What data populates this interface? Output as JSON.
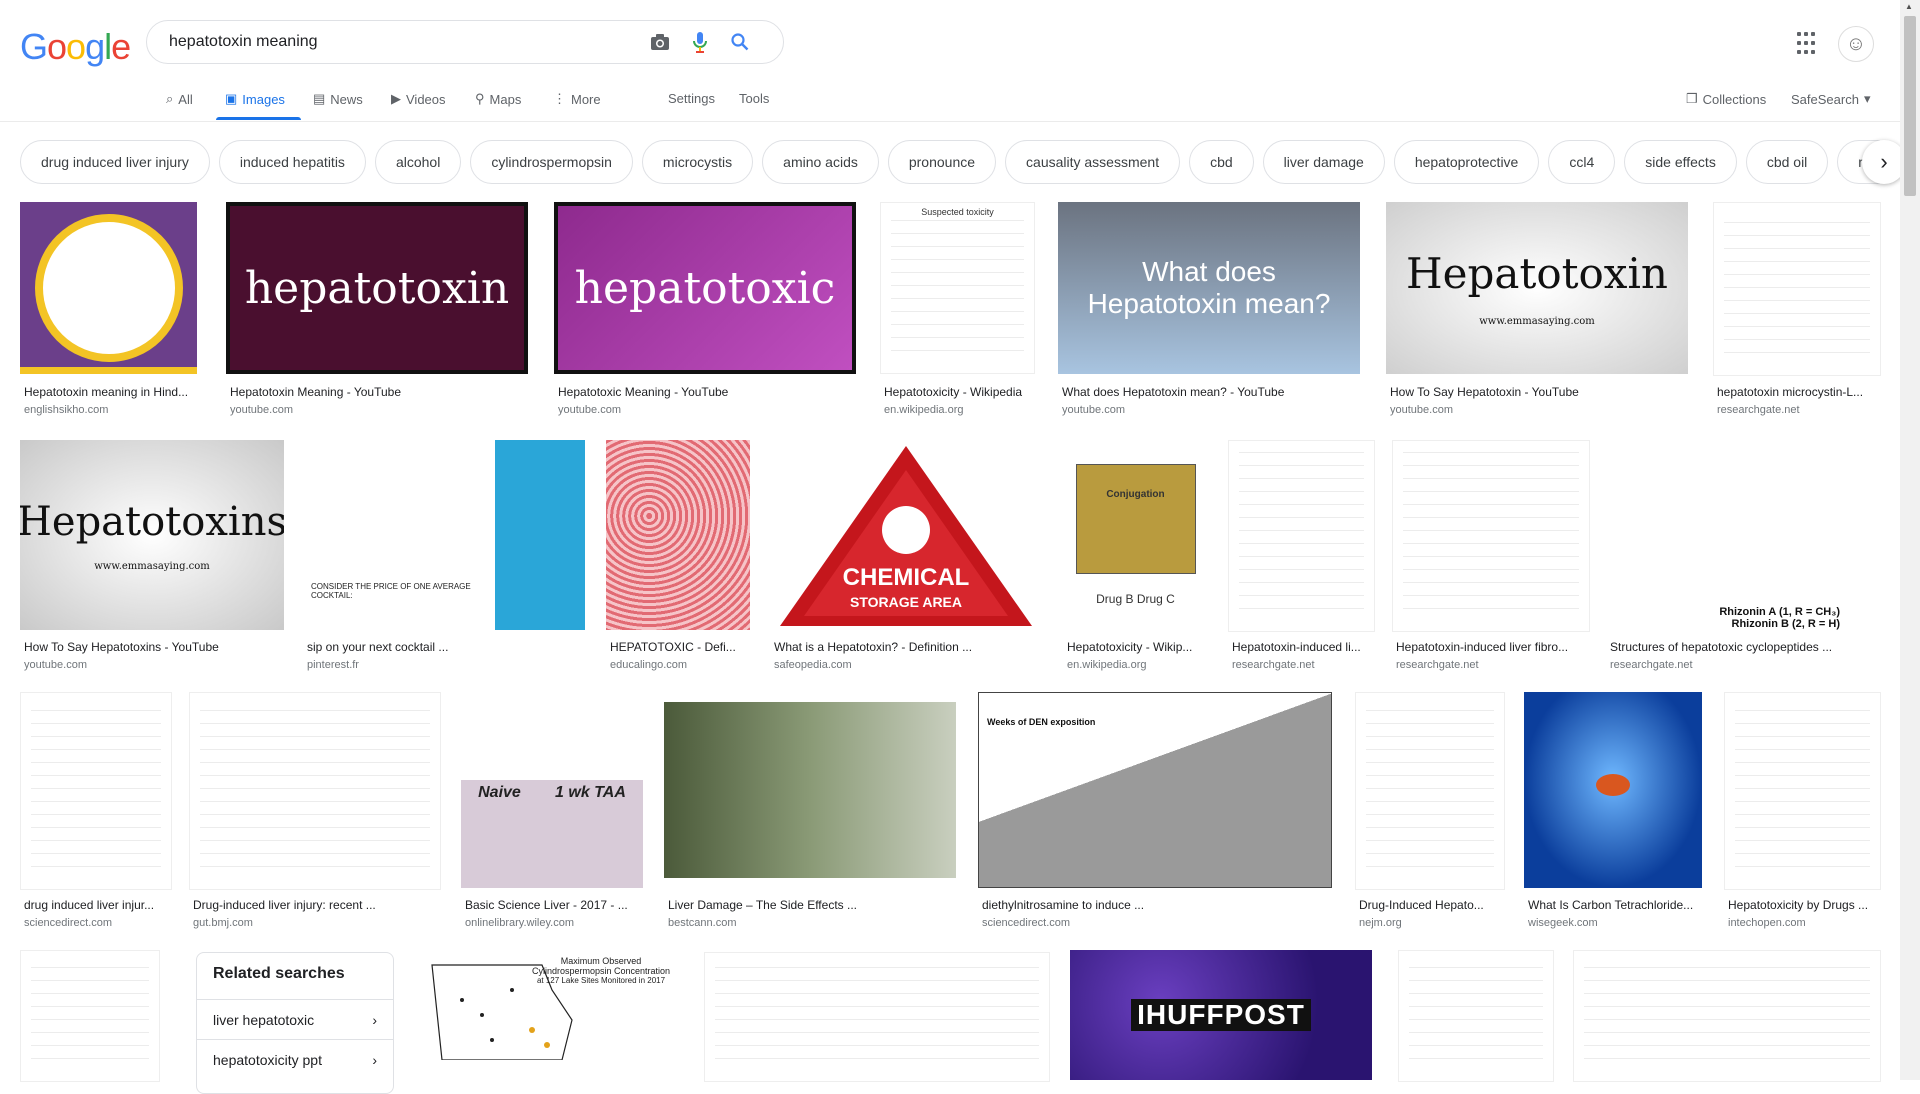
{
  "logo": {
    "g1": "G",
    "o1": "o",
    "o2": "o",
    "g2": "g",
    "l": "l",
    "e": "e"
  },
  "search": {
    "query": "hepatotoxin meaning"
  },
  "nav": {
    "tabs": [
      {
        "label": "All"
      },
      {
        "label": "Images"
      },
      {
        "label": "News"
      },
      {
        "label": "Videos"
      },
      {
        "label": "Maps"
      },
      {
        "label": "More"
      }
    ],
    "settings": "Settings",
    "tools": "Tools",
    "collections": "Collections",
    "safesearch": "SafeSearch"
  },
  "chips": [
    "drug induced liver injury",
    "induced hepatitis",
    "alcohol",
    "cylindrospermopsin",
    "microcystis",
    "amino acids",
    "pronounce",
    "causality assessment",
    "cbd",
    "liver damage",
    "hepatoprotective",
    "ccl4",
    "side effects",
    "cbd oil",
    "mic"
  ],
  "results": [
    {
      "title": "Hepatotoxin meaning in Hind...",
      "source": "englishsikho.com"
    },
    {
      "title": "Hepatotoxin Meaning - YouTube",
      "source": "youtube.com",
      "thumb_text": "hepatotoxin"
    },
    {
      "title": "Hepatotoxic Meaning - YouTube",
      "source": "youtube.com",
      "thumb_text": "hepatotoxic"
    },
    {
      "title": "Hepatotoxicity - Wikipedia",
      "source": "en.wikipedia.org",
      "thumb_text": "Suspected toxicity"
    },
    {
      "title": "What does Hepatotoxin mean? - YouTube",
      "source": "youtube.com",
      "thumb_text": "What does Hepatotoxin mean?"
    },
    {
      "title": "How To Say Hepatotoxin - YouTube",
      "source": "youtube.com",
      "thumb_text": "Hepatotoxin",
      "thumb_sub": "www.emmasaying.com"
    },
    {
      "title": "hepatotoxin microcystin-L...",
      "source": "researchgate.net"
    },
    {
      "title": "How To Say Hepatotoxins - YouTube",
      "source": "youtube.com",
      "thumb_text": "Hepatotoxins",
      "thumb_sub": "www.emmasaying.com"
    },
    {
      "title": "sip on your next cocktail ...",
      "source": "pinterest.fr",
      "thumb_text": "CONSIDER THE PRICE OF ONE AVERAGE COCKTAIL:"
    },
    {
      "title": "HEPATOTOXIC - Defi...",
      "source": "educalingo.com"
    },
    {
      "title": "What is a Hepatotoxin? - Definition ...",
      "source": "safeopedia.com",
      "thumb_text": "CHEMICAL",
      "thumb_sub": "STORAGE AREA"
    },
    {
      "title": "Hepatotoxicity - Wikip...",
      "source": "en.wikipedia.org",
      "thumb_text": "Conjugation",
      "thumb_sub": "Drug B Drug C"
    },
    {
      "title": "Hepatotoxin-induced li...",
      "source": "researchgate.net"
    },
    {
      "title": "Hepatotoxin-induced liver fibro...",
      "source": "researchgate.net"
    },
    {
      "title": "Structures of hepatotoxic cyclopeptides ...",
      "source": "researchgate.net",
      "thumb_text": "Rhizonin A (1, R = CH₃)",
      "thumb_sub": "Rhizonin B (2, R = H)"
    },
    {
      "title": "drug induced liver injur...",
      "source": "sciencedirect.com"
    },
    {
      "title": "Drug-induced liver injury: recent ...",
      "source": "gut.bmj.com"
    },
    {
      "title": "Basic Science Liver - 2017 - ...",
      "source": "onlinelibrary.wiley.com",
      "thumb_text": "Naive",
      "thumb_sub": "1 wk TAA"
    },
    {
      "title": "Liver Damage – The Side Effects ...",
      "source": "bestcann.com"
    },
    {
      "title": "diethylnitrosamine to induce ...",
      "source": "sciencedirect.com",
      "thumb_text": "Weeks of DEN exposition"
    },
    {
      "title": "Drug-Induced Hepato...",
      "source": "nejm.org"
    },
    {
      "title": "What Is Carbon Tetrachloride...",
      "source": "wisegeek.com"
    },
    {
      "title": "Hepatotoxicity by Drugs ...",
      "source": "intechopen.com"
    }
  ],
  "row4": {
    "map_title": "Maximum Observed Cylindrospermopsin Concentration",
    "map_sub": "at 127 Lake Sites Monitored in 2017",
    "huffpost": "IHUFFPOST"
  },
  "related": {
    "title": "Related searches",
    "items": [
      "liver hepatotoxic",
      "hepatotoxicity ppt"
    ]
  }
}
